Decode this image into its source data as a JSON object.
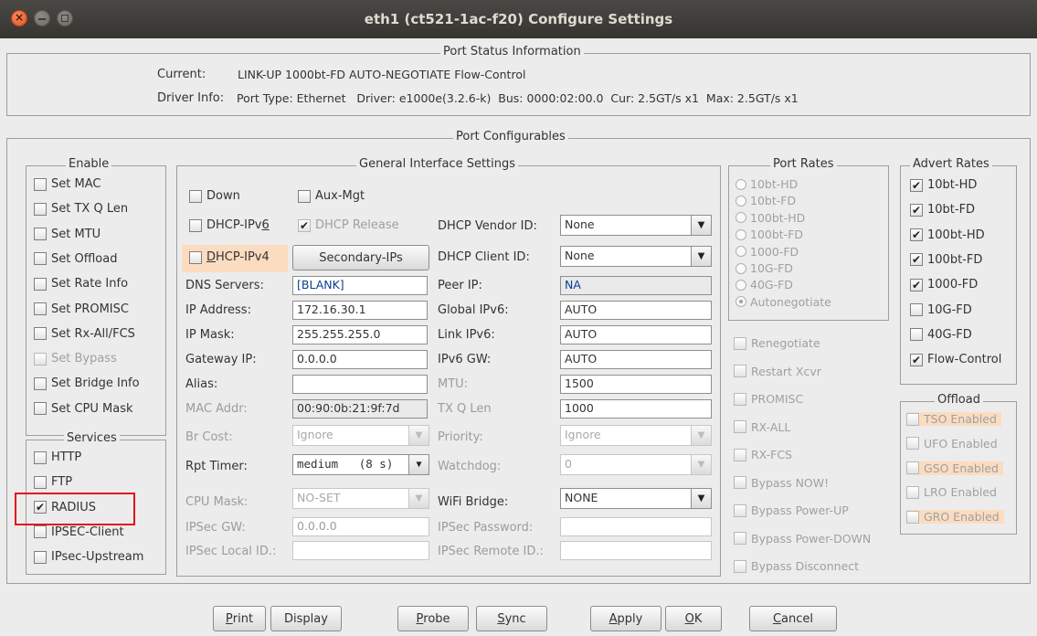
{
  "window": {
    "title": "eth1  (ct521-1ac-f20) Configure Settings"
  },
  "status": {
    "title": "Port Status Information",
    "current_label": "Current:",
    "current_value": "LINK-UP 1000bt-FD AUTO-NEGOTIATE Flow-Control",
    "driver_label": "Driver Info:",
    "driver_value": "Port Type: Ethernet   Driver: e1000e(3.2.6-k)  Bus: 0000:02:00.0  Cur: 2.5GT/s x1  Max: 2.5GT/s x1"
  },
  "configurables": {
    "title": "Port Configurables"
  },
  "enable": {
    "title": "Enable",
    "items": [
      {
        "label": "Set MAC",
        "checked": false,
        "disabled": false
      },
      {
        "label": "Set TX Q Len",
        "checked": false,
        "disabled": false
      },
      {
        "label": "Set MTU",
        "checked": false,
        "disabled": false
      },
      {
        "label": "Set Offload",
        "checked": false,
        "disabled": false
      },
      {
        "label": "Set Rate Info",
        "checked": false,
        "disabled": false
      },
      {
        "label": "Set PROMISC",
        "checked": false,
        "disabled": false
      },
      {
        "label": "Set Rx-All/FCS",
        "checked": false,
        "disabled": false
      },
      {
        "label": "Set Bypass",
        "checked": false,
        "disabled": true
      },
      {
        "label": "Set Bridge Info",
        "checked": false,
        "disabled": false
      },
      {
        "label": "Set CPU Mask",
        "checked": false,
        "disabled": false
      }
    ]
  },
  "services": {
    "title": "Services",
    "items": [
      {
        "label": "HTTP",
        "checked": false
      },
      {
        "label": "FTP",
        "checked": false
      },
      {
        "label": "RADIUS",
        "checked": true
      },
      {
        "label": "IPSEC-Client",
        "checked": false
      },
      {
        "label": "IPsec-Upstream",
        "checked": false
      }
    ]
  },
  "general": {
    "title": "General Interface Settings",
    "down": "Down",
    "aux_mgt": "Aux-Mgt",
    "dhcp_ipv6": "DHCP-IPv",
    "dhcp_ipv6_u": "6",
    "dhcp_release": "DHCP Release",
    "dhcp_ipv4_u": "D",
    "dhcp_ipv4": "HCP-IPv4",
    "secondary_ips": "Secondary-IPs",
    "dhcp_vendor_label": "DHCP Vendor ID:",
    "dhcp_vendor_value": "None",
    "dhcp_client_label": "DHCP Client ID:",
    "dhcp_client_value": "None",
    "dns_label": "DNS Servers:",
    "dns_value": "[BLANK]",
    "peer_ip_label": "Peer IP:",
    "peer_ip_value": "NA",
    "ip_label": "IP Address:",
    "ip_value": "172.16.30.1",
    "global_ipv6_label": "Global IPv6:",
    "global_ipv6_value": "AUTO",
    "mask_label": "IP Mask:",
    "mask_value": "255.255.255.0",
    "link_ipv6_label": "Link IPv6:",
    "link_ipv6_value": "AUTO",
    "gateway_label": "Gateway IP:",
    "gateway_value": "0.0.0.0",
    "ipv6gw_label": "IPv6 GW:",
    "ipv6gw_value": "AUTO",
    "alias_label": "Alias:",
    "alias_value": "",
    "mtu_label": "MTU:",
    "mtu_value": "1500",
    "mac_label": "MAC Addr:",
    "mac_value": "00:90:0b:21:9f:7d",
    "txq_label": "TX Q Len",
    "txq_value": "1000",
    "brcost_label": "Br Cost:",
    "brcost_value": "Ignore",
    "priority_label": "Priority:",
    "priority_value": "Ignore",
    "rpt_label": "Rpt Timer:",
    "rpt_value": "medium   (8 s)",
    "watchdog_label": "Watchdog:",
    "watchdog_value": "0",
    "cpumask_label": "CPU Mask:",
    "cpumask_value": "NO-SET",
    "wifibridge_label": "WiFi Bridge:",
    "wifibridge_value": "NONE",
    "ipsecgw_label": "IPSec GW:",
    "ipsecgw_value": "0.0.0.0",
    "ipsecpw_label": "IPSec Password:",
    "ipsecpw_value": "",
    "ipseclocal_label": "IPSec Local ID.:",
    "ipseclocal_value": "",
    "ipsecremote_label": "IPSec Remote ID.:",
    "ipsecremote_value": ""
  },
  "port_rates": {
    "title": "Port Rates",
    "items": [
      "10bt-HD",
      "10bt-FD",
      "100bt-HD",
      "100bt-FD",
      "1000-FD",
      "10G-FD",
      "40G-FD",
      "Autonegotiate"
    ],
    "selected": "Autonegotiate"
  },
  "misc": {
    "items": [
      "Renegotiate",
      "Restart Xcvr",
      "PROMISC",
      "RX-ALL",
      "RX-FCS",
      "Bypass NOW!",
      "Bypass Power-UP",
      "Bypass Power-DOWN",
      "Bypass Disconnect"
    ]
  },
  "advert": {
    "title": "Advert Rates",
    "items": [
      {
        "label": "10bt-HD",
        "checked": true
      },
      {
        "label": "10bt-FD",
        "checked": true
      },
      {
        "label": "100bt-HD",
        "checked": true
      },
      {
        "label": "100bt-FD",
        "checked": true
      },
      {
        "label": "1000-FD",
        "checked": true
      },
      {
        "label": "10G-FD",
        "checked": false
      },
      {
        "label": "40G-FD",
        "checked": false
      },
      {
        "label": "Flow-Control",
        "checked": true
      }
    ]
  },
  "offload": {
    "title": "Offload",
    "items": [
      "TSO Enabled",
      "UFO Enabled",
      "GSO Enabled",
      "LRO Enabled",
      "GRO Enabled"
    ]
  },
  "buttons": {
    "print_u": "P",
    "print": "rint",
    "display": "Display",
    "probe_u": "P",
    "probe": "robe",
    "sync_u": "S",
    "sync": "ync",
    "apply_u": "A",
    "apply": "pply",
    "ok_u": "O",
    "ok": "K",
    "cancel_u": "C",
    "cancel": "ancel"
  },
  "colors": {
    "highlight": "#fbdcc1",
    "annotation_red": "#e0111e"
  }
}
